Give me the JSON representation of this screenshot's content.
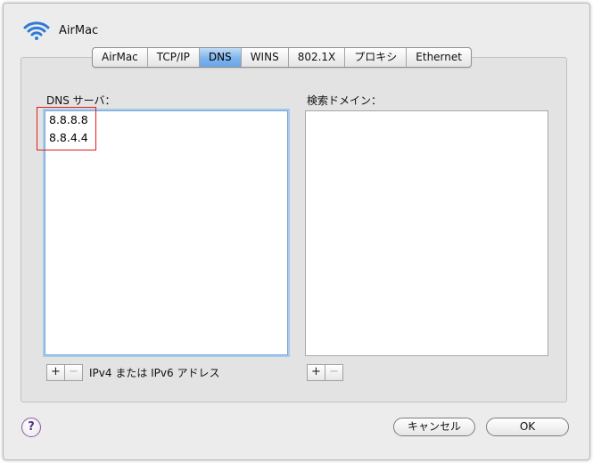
{
  "window": {
    "title": "AirMac"
  },
  "tabs": [
    {
      "label": "AirMac",
      "active": false
    },
    {
      "label": "TCP/IP",
      "active": false
    },
    {
      "label": "DNS",
      "active": true
    },
    {
      "label": "WINS",
      "active": false
    },
    {
      "label": "802.1X",
      "active": false
    },
    {
      "label": "プロキシ",
      "active": false
    },
    {
      "label": "Ethernet",
      "active": false
    }
  ],
  "dns": {
    "label": "DNS サーバ：",
    "servers": [
      "8.8.8.8",
      "8.8.4.4"
    ],
    "hint": "IPv4 または IPv6 アドレス"
  },
  "search": {
    "label": "検索ドメイン：",
    "domains": []
  },
  "buttons": {
    "add": "+",
    "remove": "−",
    "help": "?",
    "cancel": "キャンセル",
    "ok": "OK"
  },
  "icons": {
    "wifi": "wifi-icon",
    "help": "help-icon"
  },
  "colors": {
    "active_tab": "#7eb3ec",
    "highlight": "#e21b1b",
    "help": "#5b2f87"
  }
}
